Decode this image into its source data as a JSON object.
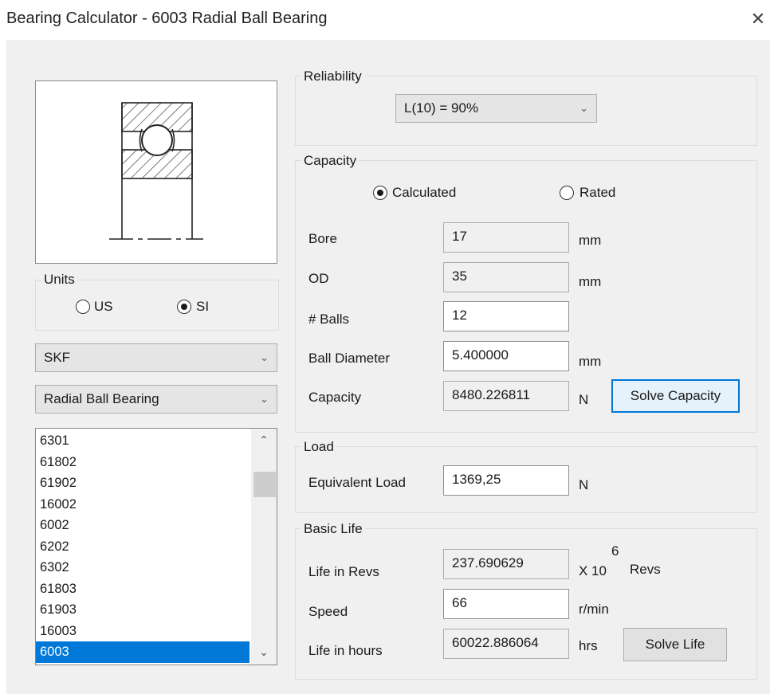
{
  "window": {
    "title": "Bearing Calculator - 6003 Radial Ball Bearing",
    "close_glyph": "✕"
  },
  "units": {
    "legend": "Units",
    "options": [
      "US",
      "SI"
    ],
    "selected": "SI"
  },
  "manufacturer": {
    "value": "SKF"
  },
  "bearing_type": {
    "value": "Radial Ball Bearing"
  },
  "part_list": {
    "items": [
      "6301",
      "61802",
      "61902",
      "16002",
      "6002",
      "6202",
      "6302",
      "61803",
      "61903",
      "16003",
      "6003"
    ],
    "selected": "6003"
  },
  "reliability": {
    "legend": "Reliability",
    "value": "L(10) = 90%"
  },
  "capacity": {
    "legend": "Capacity",
    "mode_options": [
      "Calculated",
      "Rated"
    ],
    "mode_selected": "Calculated",
    "bore": {
      "label": "Bore",
      "value": "17",
      "unit": "mm"
    },
    "od": {
      "label": "OD",
      "value": "35",
      "unit": "mm"
    },
    "balls": {
      "label": "# Balls",
      "value": "12"
    },
    "ball_diameter": {
      "label": "Ball Diameter",
      "value": "5.400000",
      "unit": "mm"
    },
    "capacity": {
      "label": "Capacity",
      "value": "8480.226811",
      "unit": "N"
    },
    "solve_label": "Solve Capacity"
  },
  "load": {
    "legend": "Load",
    "equivalent": {
      "label": "Equivalent Load",
      "value": "1369,25",
      "unit": "N"
    }
  },
  "basic_life": {
    "legend": "Basic Life",
    "revs": {
      "label": "Life in Revs",
      "value": "237.690629",
      "unit_prefix": "X 10",
      "unit_exponent": "6",
      "unit_suffix": "Revs"
    },
    "speed": {
      "label": "Speed",
      "value": "66",
      "unit": "r/min"
    },
    "hours": {
      "label": "Life in hours",
      "value": "60022.886064",
      "unit": "hrs"
    },
    "solve_label": "Solve Life"
  },
  "icons": {
    "dropdown": "chevron-down-icon",
    "scroll_up": "chevron-up-icon",
    "scroll_down": "chevron-down-icon",
    "bearing": "bearing-cross-section-icon"
  }
}
